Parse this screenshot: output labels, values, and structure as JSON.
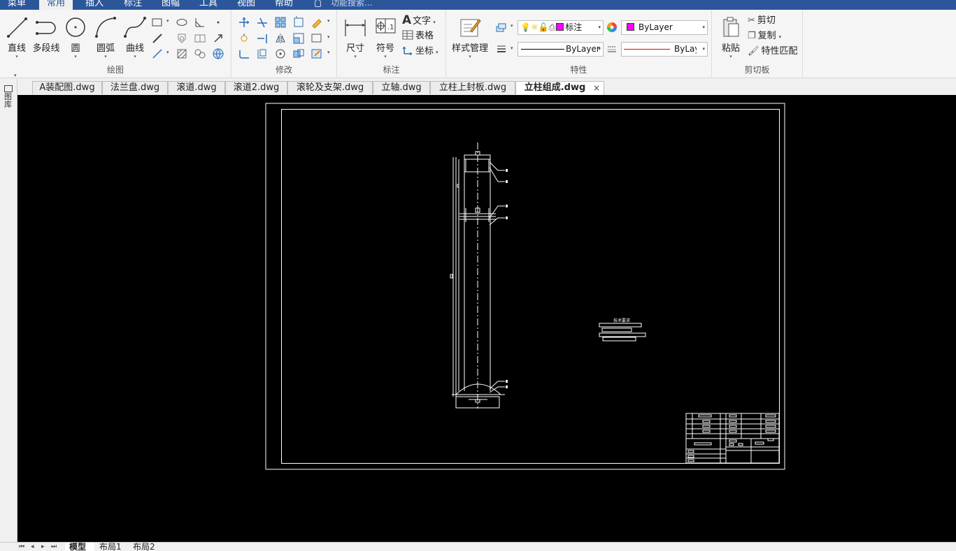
{
  "menu": {
    "items": [
      "菜单",
      "常用",
      "插入",
      "标注",
      "图幅",
      "工具",
      "视图",
      "帮助"
    ],
    "active": "常用",
    "search_placeholder": "功能搜索..."
  },
  "ribbon": {
    "draw": {
      "label": "绘图",
      "line": "直线",
      "polyline": "多段线",
      "circle": "圆",
      "arc": "圆弧",
      "curve": "曲线"
    },
    "modify": {
      "label": "修改"
    },
    "annotate": {
      "label": "标注",
      "dimension": "尺寸",
      "symbol": "符号",
      "text": "文字",
      "table": "表格",
      "coord": "坐标"
    },
    "properties": {
      "label": "特性",
      "style_manager": "样式管理",
      "layer_name": "标注",
      "color_value": "ByLayer",
      "linetype_value": "ByLayer",
      "lineweight_value": "ByLayer",
      "color_swatch": "#ff00ff"
    },
    "clipboard": {
      "label": "剪切板",
      "paste": "粘贴",
      "cut": "剪切",
      "copy": "复制",
      "match_props": "特性匹配"
    }
  },
  "doc_tabs": [
    "A装配图.dwg",
    "法兰盘.dwg",
    "滚道.dwg",
    "滚道2.dwg",
    "滚轮及支架.dwg",
    "立轴.dwg",
    "立柱上封板.dwg",
    "立柱组成.dwg"
  ],
  "active_doc": "立柱组成.dwg",
  "close_glyph": "×",
  "left_panel_label": "图库",
  "layout_tabs": [
    "模型",
    "布局1",
    "布局2"
  ],
  "active_layout": "模型",
  "drawing": {
    "tech_req_label": "技术要求"
  },
  "colors": {
    "menu_bg": "#2b579a",
    "canvas_bg": "#000000",
    "drawing_lines": "#ffffff"
  }
}
